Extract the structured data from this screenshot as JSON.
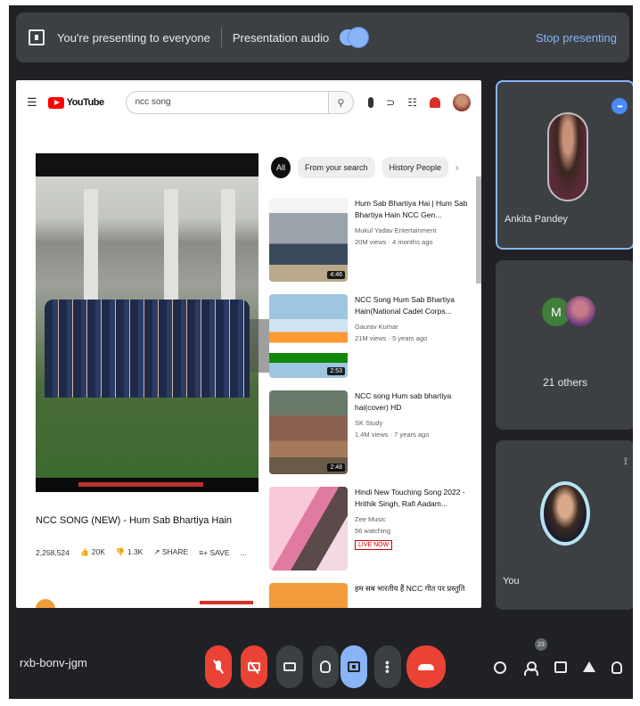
{
  "present_bar": {
    "status": "You're presenting to everyone",
    "audio_label": "Presentation audio",
    "audio_on": true,
    "stop_label": "Stop presenting"
  },
  "youtube": {
    "logo_text": "YouTube",
    "search_value": "ncc song",
    "video_title": "NCC SONG (NEW) - Hum Sab Bhartiya Hain",
    "actions": {
      "views": "2,258,524",
      "likes": "20K",
      "dislikes": "1.3K",
      "share": "SHARE",
      "save": "SAVE",
      "more": "..."
    },
    "chips": [
      "All",
      "From your search",
      "History People"
    ],
    "recommendations": [
      {
        "title": "Hum Sab Bhartiya Hai | Hum Sab Bhartiya Hain NCC Gen...",
        "channel": "Mukul Yadav Entertainment",
        "views": "20M views · 4 months ago",
        "duration": "4:46"
      },
      {
        "title": "NCC Song Hum Sab Bhartiya Hain(National Cadet Corps...",
        "channel": "Gaurav Kumar",
        "views": "21M views · 5 years ago",
        "duration": "2:53"
      },
      {
        "title": "NCC song Hum sab bhartiya hai(cover) HD",
        "channel": "SK Study",
        "views": "1.4M views · 7 years ago",
        "duration": "2:48"
      },
      {
        "title": "Hindi New Touching Song 2022 - Hrithik Singh, Rafi Aadam...",
        "channel": "Zee Music",
        "views": "56 watching",
        "live": "LIVE NOW",
        "duration": ""
      },
      {
        "title": "हम सब भारतीय हैं NCC गीत पर प्रस्तुति",
        "channel": "",
        "views": "",
        "duration": ""
      }
    ]
  },
  "participants": [
    {
      "name": "Ankita Pandey",
      "speaking": true
    },
    {
      "label": "21 others",
      "initial": "M"
    },
    {
      "name": "You"
    }
  ],
  "controls": {
    "meeting_code": "rxb-bonv-jgm",
    "participant_count": "23"
  }
}
